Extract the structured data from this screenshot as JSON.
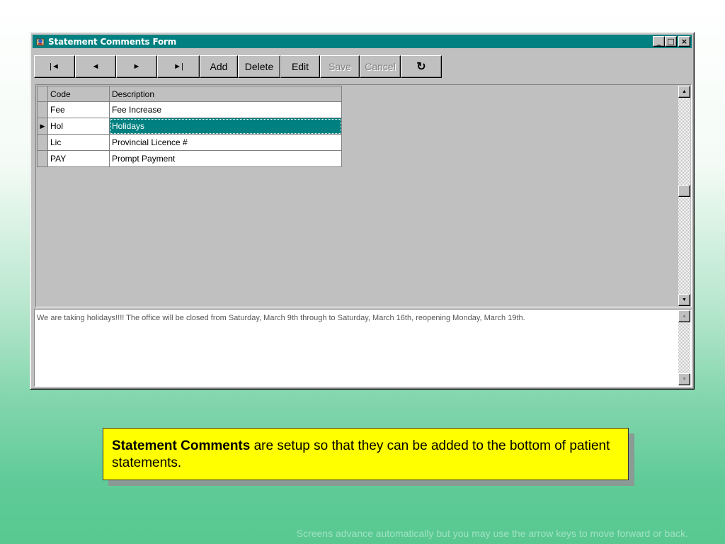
{
  "window": {
    "title": "Statement Comments Form",
    "controls": {
      "minimize": "_",
      "maximize": "□",
      "close": "×"
    }
  },
  "toolbar": {
    "first": "|◄",
    "prev": "◄",
    "next": "►",
    "last": "►|",
    "add": "Add",
    "delete": "Delete",
    "edit": "Edit",
    "save": "Save",
    "cancel": "Cancel",
    "refresh": "↻"
  },
  "grid": {
    "columns": [
      "Code",
      "Description"
    ],
    "rows": [
      {
        "code": "Fee",
        "description": "Fee Increase",
        "selected": false
      },
      {
        "code": "Hol",
        "description": "Holidays",
        "selected": true
      },
      {
        "code": "Lic",
        "description": "Provincial Licence #",
        "selected": false
      },
      {
        "code": "PAY",
        "description": "Prompt Payment",
        "selected": false
      }
    ],
    "current_row_marker": "▶"
  },
  "memo": {
    "text": "We are taking holidays!!!! The office will be closed from Saturday, March 9th through to Saturday, March 16th, reopening Monday, March 19th."
  },
  "callout": {
    "bold": "Statement Comments",
    "rest": " are setup so that they can be added to the bottom of patient statements."
  },
  "footer": {
    "text": "Screens advance automatically but you may use the arrow keys to move forward or back."
  },
  "colors": {
    "titlebar": "#008080",
    "selection": "#008080",
    "callout": "#ffff00",
    "window": "#c0c0c0"
  }
}
